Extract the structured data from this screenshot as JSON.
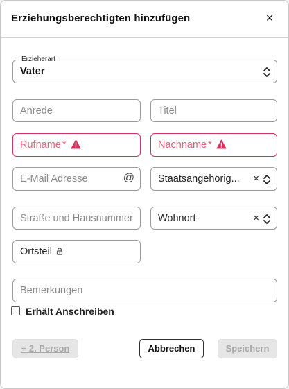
{
  "dialog": {
    "title": "Erziehungsberechtigten hinzufügen",
    "close_label": "×"
  },
  "form": {
    "erzieherart": {
      "label": "Erzieherart",
      "value": "Vater"
    },
    "anrede": {
      "placeholder": "Anrede"
    },
    "titel": {
      "placeholder": "Titel"
    },
    "rufname": {
      "placeholder": "Rufname",
      "required_mark": "*"
    },
    "nachname": {
      "placeholder": "Nachname",
      "required_mark": "*"
    },
    "email": {
      "placeholder": "E-Mail Adresse",
      "icon_glyph": "@"
    },
    "staatsangehoerigkeit": {
      "value": "Staatsangehörig...",
      "clear_label": "×"
    },
    "strasse": {
      "placeholder": "Straße und Hausnummer"
    },
    "wohnort": {
      "value": "Wohnort",
      "clear_label": "×"
    },
    "ortsteil": {
      "value": "Ortsteil"
    },
    "bemerkungen": {
      "placeholder": "Bemerkungen"
    },
    "anschreiben": {
      "label": "Erhält Anschreiben",
      "checked": false
    }
  },
  "actions": {
    "add_person_plus": "+",
    "add_person_label": "2. Person",
    "cancel_label": "Abbrechen",
    "save_label": "Speichern"
  },
  "colors": {
    "error": "#d6315d",
    "error_text": "#e2627f",
    "border": "#9b9b9b",
    "disabled_bg": "#e6e6e6"
  },
  "icons": {
    "close": "close-icon",
    "chevron": "chevron-up-down-icon",
    "warning": "warning-triangle-icon",
    "email": "at-sign-icon",
    "lock": "lock-icon"
  }
}
